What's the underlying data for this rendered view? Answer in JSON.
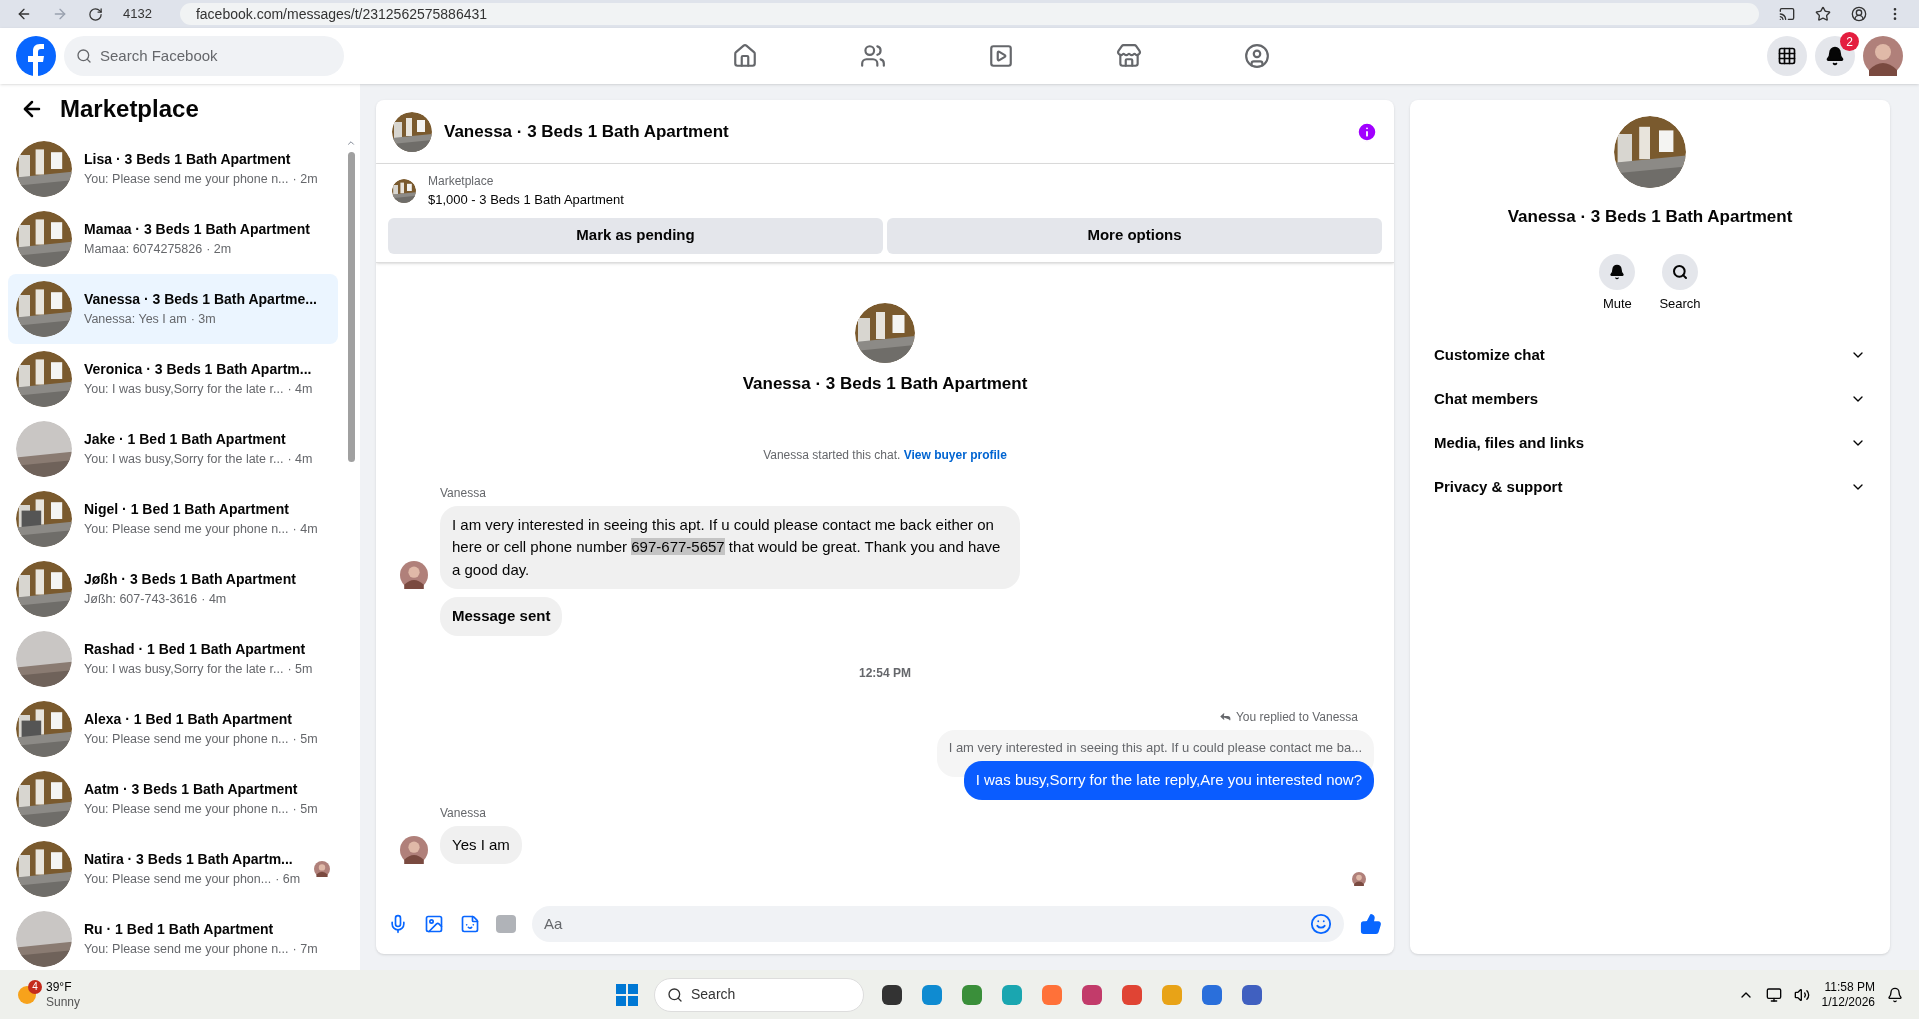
{
  "browser": {
    "tab_count": "4132",
    "url": "facebook.com/messages/t/2312562575886431"
  },
  "nav": {
    "search_placeholder": "Search Facebook",
    "notification_count": "2"
  },
  "sidebar": {
    "title": "Marketplace",
    "conversations": [
      {
        "title": "Lisa · 3 Beds 1 Bath Apartment",
        "preview": "You: Please send me your phone n...",
        "time": "· 2m",
        "selected": false
      },
      {
        "title": "Mamaa · 3 Beds 1 Bath Apartment",
        "preview": "Mamaa: 6074275826",
        "time": "· 2m",
        "selected": false
      },
      {
        "title": "Vanessa · 3 Beds 1 Bath Apartme...",
        "preview": "Vanessa: Yes I am",
        "time": "· 3m",
        "selected": true
      },
      {
        "title": "Veronica · 3 Beds 1 Bath Apartm...",
        "preview": "You: I was busy,Sorry for the late r...",
        "time": "· 4m",
        "selected": false
      },
      {
        "title": "Jake · 1 Bed 1 Bath Apartment",
        "preview": "You: I was busy,Sorry for the late r...",
        "time": "· 4m",
        "selected": false
      },
      {
        "title": "Nigel · 1 Bed 1 Bath Apartment",
        "preview": "You: Please send me your phone n...",
        "time": "· 4m",
        "selected": false
      },
      {
        "title": "Jøßh · 3 Beds 1 Bath Apartment",
        "preview": "Jøßh: 607-743-3616",
        "time": "· 4m",
        "selected": false
      },
      {
        "title": "Rashad · 1 Bed 1 Bath Apartment",
        "preview": "You: I was busy,Sorry for the late r...",
        "time": "· 5m",
        "selected": false
      },
      {
        "title": "Alexa · 1 Bed 1 Bath Apartment",
        "preview": "You: Please send me your phone n...",
        "time": "· 5m",
        "selected": false
      },
      {
        "title": "Aatm · 3 Beds 1 Bath Apartment",
        "preview": "You: Please send me your phone n...",
        "time": "· 5m",
        "selected": false
      },
      {
        "title": "Natira · 3 Beds 1 Bath Apartm...",
        "preview": "You: Please send me your phon...",
        "time": "· 6m",
        "selected": false
      },
      {
        "title": "Ru · 1 Bed 1 Bath Apartment",
        "preview": "You: Please send me your phone n...",
        "time": "· 7m",
        "selected": false
      }
    ]
  },
  "chat": {
    "title": "Vanessa · 3 Beds 1 Bath Apartment",
    "listing": {
      "label": "Marketplace",
      "title": "$1,000 - 3 Beds 1 Bath Apartment"
    },
    "buttons": [
      "Mark as pending",
      "More options"
    ],
    "intro_title": "Vanessa · 3 Beds 1 Bath Apartment",
    "started_text": "Vanessa started this chat.",
    "started_link": "View buyer profile",
    "messages": [
      {
        "kind": "incoming",
        "sender": "Vanessa",
        "parts": [
          {
            "text": "I am very interested in seeing this apt. If u could please contact me back either on here or cell phone number ",
            "highlighted": false
          },
          {
            "text": "697-677-5657",
            "highlighted": true
          },
          {
            "text": " that would be great. Thank you and have a good day.",
            "highlighted": false
          }
        ]
      },
      {
        "kind": "notice",
        "text": "Message sent"
      },
      {
        "kind": "time",
        "text": "12:54 PM"
      },
      {
        "kind": "reply",
        "label": "You replied to Vanessa",
        "quoted": "I am very interested in seeing this apt. If u could please contact me ba...",
        "text": "I was busy,Sorry for the late reply,Are you interested now?"
      },
      {
        "kind": "incoming",
        "sender": "Vanessa",
        "parts": [
          {
            "text": "Yes I am",
            "highlighted": false
          }
        ]
      }
    ],
    "composer_placeholder": "Aa"
  },
  "details": {
    "title": "Vanessa · 3 Beds 1 Bath Apartment",
    "actions": [
      "Mute",
      "Search"
    ],
    "sections": [
      {
        "label": "Customize chat",
        "expanded": false
      },
      {
        "label": "Chat members",
        "expanded": false
      },
      {
        "label": "Media, files and links",
        "expanded": false
      },
      {
        "label": "Privacy & support",
        "expanded": false
      }
    ]
  },
  "taskbar": {
    "weather_badge": "4",
    "temperature": "39°F",
    "condition": "Sunny",
    "search_placeholder": "Search",
    "time": "11:58 PM",
    "date": "1/12/2026"
  }
}
